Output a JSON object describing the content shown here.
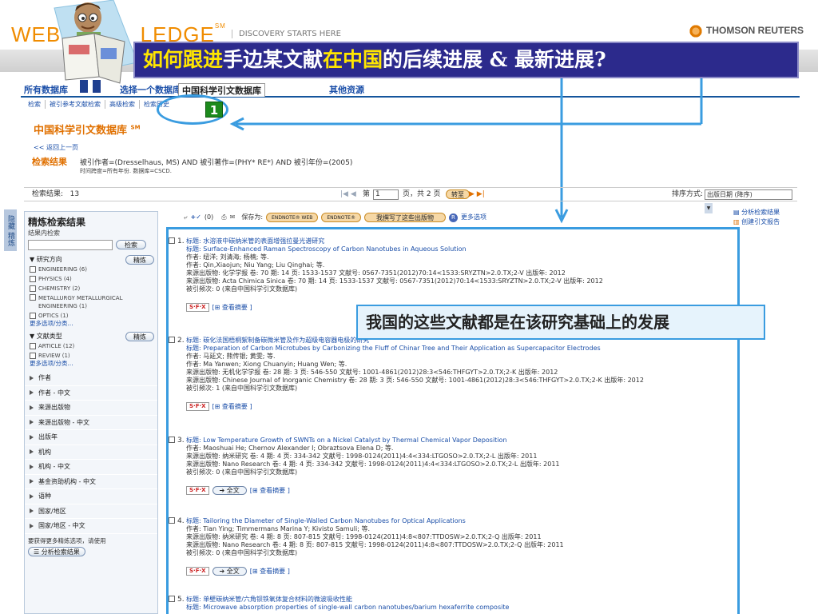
{
  "header": {
    "logo_left": "WEB O",
    "logo_right": "LEDGE",
    "logo_mark": "SM",
    "tagline": "DISCOVERY STARTS HERE",
    "brand": "THOMSON REUTERS"
  },
  "banner": {
    "part1": "如何跟进",
    "part2": "手边某文献",
    "part3": "在中国",
    "part4": "的后续进展 & 最新进展?"
  },
  "tabs": [
    "所有数据库",
    "选择一个数据库",
    "中国科学引文数据库",
    "其他资源"
  ],
  "subnav": [
    "检索",
    "被引参考文献检索",
    "高级检索",
    "检索历史"
  ],
  "step_badge": "1",
  "db_title": "中国科学引文数据库",
  "db_mark": "SM",
  "back_link": "<< 返回上一页",
  "search_result": {
    "label": "检索结果",
    "query": "被引作者=(Dresselhaus, MS) AND 被引著作=(PHY* RE*) AND 被引年份=(2005)",
    "range": "时间跨度=所有年份. 数据库=CSCD."
  },
  "toolbar": {
    "count_label": "检索结果:",
    "count": "13",
    "page_label": "第",
    "page_value": "1",
    "page_total": "页，共 2 页",
    "go": "转至",
    "sort_label": "排序方式:",
    "sort_value": "出版日期 (降序)",
    "marked": "(0)",
    "save_as": "保存为:",
    "endnote_web": "ENDNOTE® WEB",
    "endnote": "ENDNOTE®",
    "rwrite": "我撰写了这些出版物",
    "more": "更多选项"
  },
  "right_tools": [
    "分析检索结果",
    "创建引文报告"
  ],
  "side_tab": "隐藏 精炼",
  "refine": {
    "title": "精炼检索结果",
    "within": "结果内检索",
    "search_btn": "检索",
    "refine_btn": "精炼",
    "research_area": "研究方向",
    "areas": [
      "ENGINEERING (6)",
      "PHYSICS (4)",
      "CHEMISTRY (2)",
      "METALLURGY METALLURGICAL ENGINEERING (1)",
      "OPTICS (1)"
    ],
    "more_options": "更多选项/分类...",
    "doc_type": "文献类型",
    "doc_types": [
      "ARTICLE (12)",
      "REVIEW (1)"
    ],
    "facets": [
      "作者",
      "作者 - 中文",
      "来源出版物",
      "来源出版物 - 中文",
      "出版年",
      "机构",
      "机构 - 中文",
      "基金资助机构 - 中文",
      "语种",
      "国家/地区",
      "国家/地区 - 中文"
    ],
    "footer": "要获得更多精炼选项，请使用",
    "analyze_btn": "分析检索结果"
  },
  "callout": "我国的这些文献都是在该研究基础上的发展",
  "records": [
    {
      "num": "1.",
      "title_cn": "标题: 水溶液中碳纳米管的表面增强拉曼光谱研究",
      "title_en": "标题: Surface-Enhanced Raman Spectroscopy of Carbon Nanotubes in Aqueous Solution",
      "author_cn": "作者: 纽洋; 刘清海; 杨楠; 等.",
      "author_en": "作者: Qin,Xiaojun; Niu Yang; Liu Qinghai; 等.",
      "source_cn": "来源出版物: 化学学报 卷: 70 期: 14 页: 1533-1537 文献号: 0567-7351(2012)70:14<1533:SRYZTN>2.0.TX;2-V 出版年: 2012",
      "source_en": "来源出版物: Acta Chimica Sinica 卷: 70 期: 14 页: 1533-1537 文献号: 0567-7351(2012)70:14<1533:SRYZTN>2.0.TX;2-V 出版年: 2012",
      "cited": "被引频次: 0 (来自中国科学引文数据库)",
      "fulltext": ""
    },
    {
      "num": "2.",
      "title_cn": "标题: 碳化法国梧桐絮制备碳微米管及作为超级电容器电极的研究",
      "title_en": "标题: Preparation of Carbon Microtubes by Carbonizing the Fluff of Chinar Tree and Their Application as Supercapacitor Electrodes",
      "author_cn": "作者: 马延文; 熊传银; 黄雯; 等.",
      "author_en": "作者: Ma Yanwen; Xiong Chuanyin; Huang Wen; 等.",
      "source_cn": "来源出版物: 无机化学学报 卷: 28 期: 3 页: 546-550 文献号: 1001-4861(2012)28:3<546:THFGYT>2.0.TX;2-K 出版年: 2012",
      "source_en": "来源出版物: Chinese Journal of Inorganic Chemistry 卷: 28 期: 3 页: 546-550 文献号: 1001-4861(2012)28:3<546:THFGYT>2.0.TX;2-K 出版年: 2012",
      "cited": "被引频次: 1 (来自中国科学引文数据库)",
      "fulltext": ""
    },
    {
      "num": "3.",
      "title_en": "标题: Low Temperature Growth of SWNTs on a Nickel Catalyst by Thermal Chemical Vapor Deposition",
      "author_en": "作者: Maoshuai He; Chernov Alexander I; Obraztsova Elena D; 等.",
      "source_cn": "来源出版物: 纳米研究 卷: 4 期: 4 页: 334-342 文献号: 1998-0124(2011)4:4<334:LTGOSO>2.0.TX;2-L 出版年: 2011",
      "source_en": "来源出版物: Nano Research 卷: 4 期: 4 页: 334-342 文献号: 1998-0124(2011)4:4<334:LTGOSO>2.0.TX;2-L 出版年: 2011",
      "cited": "被引频次: 0 (来自中国科学引文数据库)",
      "fulltext": "全文"
    },
    {
      "num": "4.",
      "title_en": "标题: Tailoring the Diameter of Single-Walled Carbon Nanotubes for Optical Applications",
      "author_en": "作者: Tian Ying; Timmermans Marina Y; Kivisto Samuli; 等.",
      "source_cn": "来源出版物: 纳米研究 卷: 4 期: 8 页: 807-815 文献号: 1998-0124(2011)4:8<807:TTDOSW>2.0.TX;2-Q 出版年: 2011",
      "source_en": "来源出版物: Nano Research 卷: 4 期: 8 页: 807-815 文献号: 1998-0124(2011)4:8<807:TTDOSW>2.0.TX;2-Q 出版年: 2011",
      "cited": "被引频次: 0 (来自中国科学引文数据库)",
      "fulltext": "全文"
    },
    {
      "num": "5.",
      "title_cn": "标题: 单壁碳纳米管/六角钡铁氧体复合材料的微波吸收性能",
      "title_en": "标题: Microwave absorption properties of single-wall carbon nanotubes/barium hexaferrite composite"
    }
  ],
  "sfx_label": "S·F·X",
  "abstract_link": "查看摘要"
}
